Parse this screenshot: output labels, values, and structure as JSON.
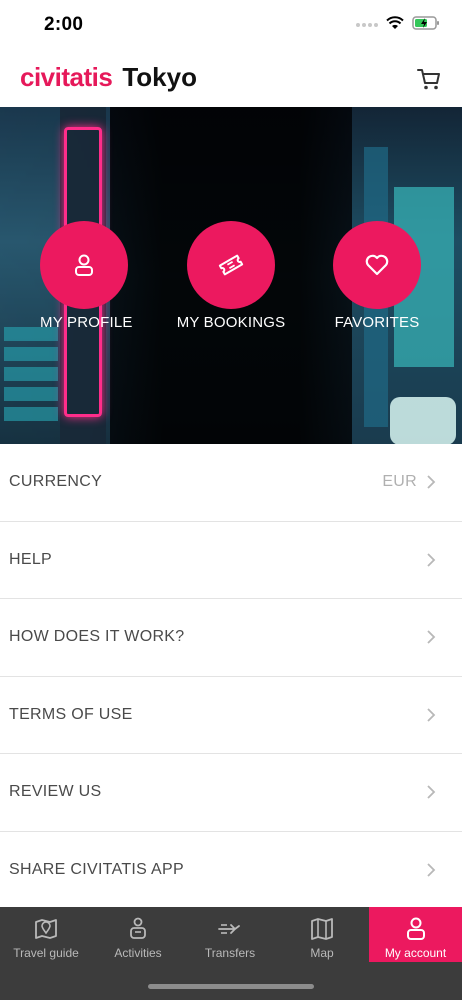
{
  "status_bar": {
    "time": "2:00"
  },
  "header": {
    "brand": "civitatis",
    "city": "Tokyo"
  },
  "hero": {
    "buttons": [
      {
        "label": "MY PROFILE",
        "icon": "person-icon"
      },
      {
        "label": "MY BOOKINGS",
        "icon": "ticket-icon"
      },
      {
        "label": "FAVORITES",
        "icon": "heart-icon"
      }
    ]
  },
  "menu": {
    "items": [
      {
        "label": "CURRENCY",
        "value": "EUR"
      },
      {
        "label": "HELP"
      },
      {
        "label": "HOW DOES IT WORK?"
      },
      {
        "label": "TERMS OF USE"
      },
      {
        "label": "REVIEW US"
      },
      {
        "label": "SHARE CIVITATIS APP"
      }
    ]
  },
  "tabbar": {
    "tabs": [
      {
        "label": "Travel guide",
        "icon": "map-pin-icon"
      },
      {
        "label": "Activities",
        "icon": "activities-icon"
      },
      {
        "label": "Transfers",
        "icon": "transfers-icon"
      },
      {
        "label": "Map",
        "icon": "map-icon"
      },
      {
        "label": "My account",
        "icon": "account-icon",
        "active": true
      }
    ]
  },
  "colors": {
    "accent": "#ec195f",
    "brand": "#e6195a",
    "tabbar_bg": "#3c3c3c"
  }
}
